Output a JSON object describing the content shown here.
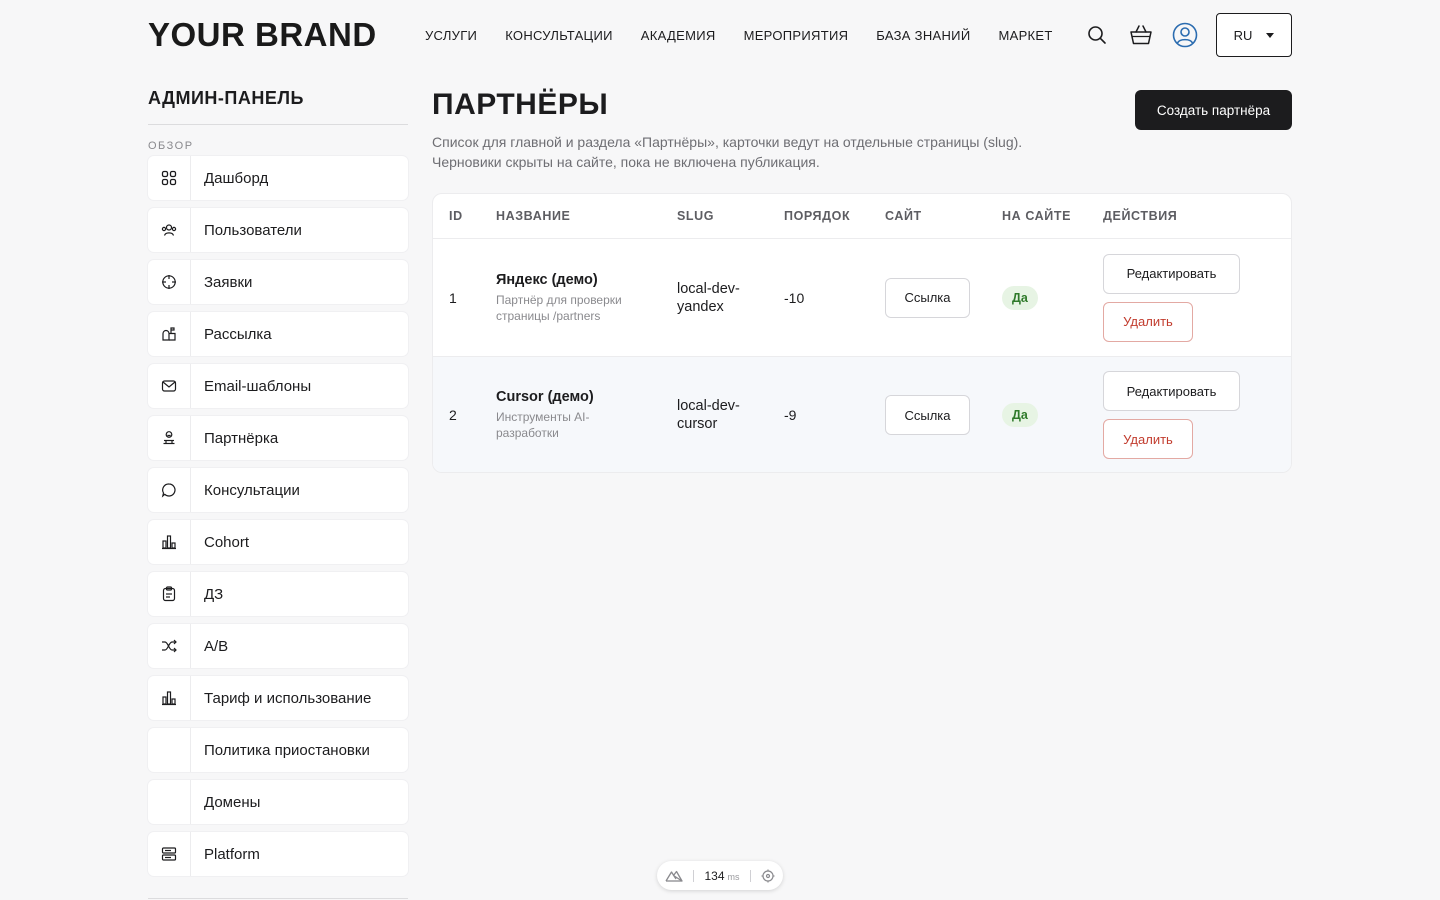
{
  "header": {
    "brand": "YOUR BRAND",
    "nav": [
      "УСЛУГИ",
      "КОНСУЛЬТАЦИИ",
      "АКАДЕМИЯ",
      "МЕРОПРИЯТИЯ",
      "БАЗА ЗНАНИЙ",
      "МАРКЕТ"
    ],
    "language": "RU"
  },
  "sidebar": {
    "title": "АДМИН-ПАНЕЛЬ",
    "section": "ОБЗОР",
    "items": [
      {
        "label": "Дашборд",
        "icon": "grid-icon"
      },
      {
        "label": "Пользователи",
        "icon": "users-icon"
      },
      {
        "label": "Заявки",
        "icon": "target-icon"
      },
      {
        "label": "Рассылка",
        "icon": "mailbox-icon"
      },
      {
        "label": "Email-шаблоны",
        "icon": "envelope-icon"
      },
      {
        "label": "Партнёрка",
        "icon": "partner-icon"
      },
      {
        "label": "Консультации",
        "icon": "chat-bubble-icon"
      },
      {
        "label": "Cohort",
        "icon": "bar-chart-icon"
      },
      {
        "label": "ДЗ",
        "icon": "clipboard-icon"
      },
      {
        "label": "A/B",
        "icon": "shuffle-icon"
      },
      {
        "label": "Тариф и использование",
        "icon": "bar-chart-icon"
      },
      {
        "label": "Политика приостановки",
        "icon": ""
      },
      {
        "label": "Домены",
        "icon": ""
      },
      {
        "label": "Platform",
        "icon": "server-icon"
      }
    ]
  },
  "main": {
    "title": "ПАРТНЁРЫ",
    "description": "Список для главной и раздела «Партнёры», карточки ведут на отдельные страницы (slug). Черновики скрыты на сайте, пока не включена публикация.",
    "create_button": "Создать партнёра",
    "table": {
      "headers": [
        "ID",
        "НАЗВАНИЕ",
        "SLUG",
        "ПОРЯДОК",
        "САЙТ",
        "НА САЙТЕ",
        "ДЕЙСТВИЯ"
      ],
      "rows": [
        {
          "id": "1",
          "name": "Яндекс (демо)",
          "subtitle": "Партнёр для проверки страницы /partners",
          "slug": "local-dev-yandex",
          "slug_line1": "local-dev-",
          "slug_line2": "yandex",
          "order": "-10",
          "site": "Ссылка",
          "on_site": "Да",
          "edit": "Редактировать",
          "delete": "Удалить"
        },
        {
          "id": "2",
          "name": "Cursor (демо)",
          "subtitle": "Инструменты AI-разработки",
          "slug": "local-dev-cursor",
          "slug_line1": "local-dev-",
          "slug_line2": "cursor",
          "order": "-9",
          "site": "Ссылка",
          "on_site": "Да",
          "edit": "Редактировать",
          "delete": "Удалить"
        }
      ]
    }
  },
  "perf": {
    "value": "134",
    "unit": "ms"
  },
  "colors": {
    "accent": "#1c1c1e",
    "danger": "#c23c2e",
    "success_bg": "#e7f4e4",
    "success_text": "#2f7a2a",
    "avatar": "#2b6cb0"
  }
}
